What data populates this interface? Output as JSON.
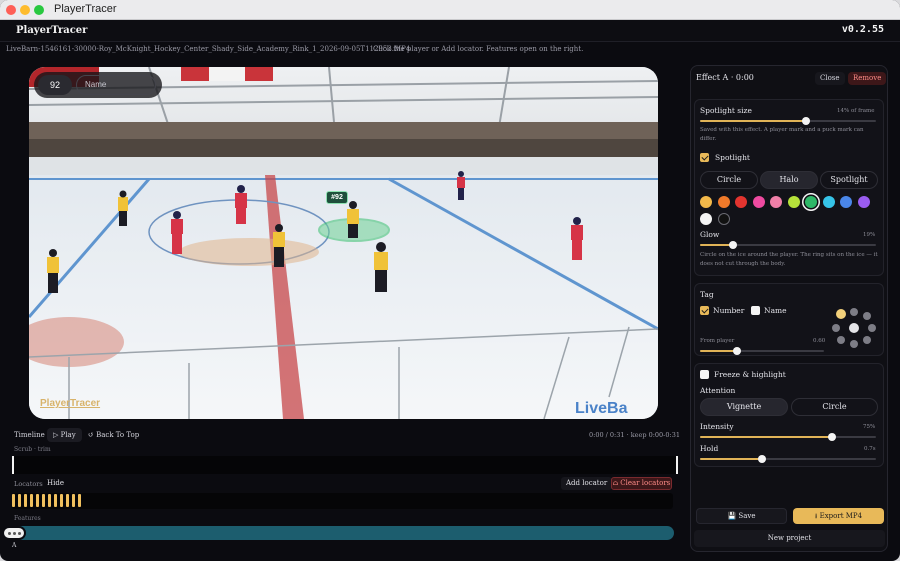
{
  "window": {
    "title": "PlayerTracer"
  },
  "app": {
    "name": "PlayerTracer",
    "version": "v0.2.55"
  },
  "info": {
    "filename": "LiveBarn-1546161-30000-Roy_McKnight_Hockey_Center_Shady_Side_Academy_Rink_1_2026-09-05T112953.MP4",
    "hint": "Click the player or Add locator. Features open on the right."
  },
  "video": {
    "hud_number": "92",
    "hud_name_placeholder": "Name",
    "player_tag": "#92",
    "watermark_left": "PlayerTracer",
    "watermark_right": "LiveBa"
  },
  "timeline": {
    "label": "Timeline",
    "play": "▷ Play",
    "back_to_top": "↺ Back To Top",
    "time_readout": "0:00 / 0:31 · keep 0:00-0:31",
    "scrub_label": "Scrub · trim",
    "locators_label": "Locators",
    "hide": "Hide",
    "add_locator": "Add locator",
    "clear_locators": "⌂ Clear locators",
    "locator_count": 12,
    "features_label": "Features",
    "feature_marker": "A"
  },
  "panel": {
    "title": "Effect A · 0:00",
    "close": "Close",
    "remove": "Remove",
    "spotlight_size": {
      "label": "Spotlight size",
      "value": "14% of frame",
      "fraction": 0.6
    },
    "spotlight_desc": "Saved with this effect. A player mark and a puck mark can differ.",
    "spotlight_check": {
      "label": "Spotlight",
      "checked": true
    },
    "shapes": [
      "Circle",
      "Halo",
      "Spotlight"
    ],
    "active_shape": "Halo",
    "colors": [
      "#f2b84a",
      "#f07a2a",
      "#e3342f",
      "#ef4aa0",
      "#f07fa8",
      "#b6e23a",
      "#2fb868",
      "#36c4e8",
      "#4a86e8",
      "#9a5cf0",
      "#f4f4f4",
      "#111111"
    ],
    "selected_color": "#2fb868",
    "glow": {
      "label": "Glow",
      "value": "19%",
      "fraction": 0.19
    },
    "glow_desc": "Circle on the ice around the player. The ring sits on the ice — it does not cut through the body.",
    "tag": {
      "title": "Tag",
      "number_label": "Number",
      "number_checked": true,
      "name_label": "Name",
      "name_checked": false,
      "from_player_label": "From player",
      "from_player_value": "0.60",
      "from_player_fraction": 0.3
    },
    "freeze": {
      "label": "Freeze & highlight",
      "checked": false
    },
    "attention": {
      "label": "Attention",
      "options": [
        "Vignette",
        "Circle"
      ],
      "active": "Vignette"
    },
    "intensity": {
      "label": "Intensity",
      "value": "75%",
      "fraction": 0.75
    },
    "hold": {
      "label": "Hold",
      "value": "0.7s",
      "fraction": 0.35
    },
    "save": "💾 Save",
    "export": "⭳ Export MP4",
    "new_project": "New project"
  }
}
